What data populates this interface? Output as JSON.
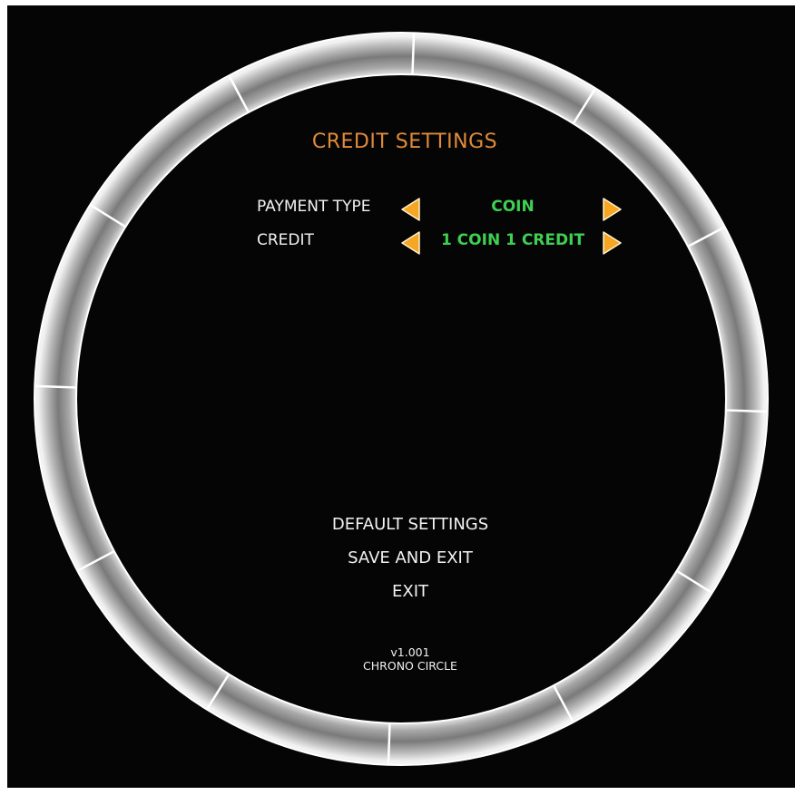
{
  "screen": {
    "title": "CREDIT SETTINGS",
    "colors": {
      "background": "#050505",
      "title": "#e08a3a",
      "label": "#f2f2f2",
      "value": "#3fcf52",
      "arrow": "#f5a623",
      "ring": "#d9d9d9"
    }
  },
  "settings": [
    {
      "label": "PAYMENT TYPE",
      "value": "COIN",
      "left_icon": "arrow-left-icon",
      "right_icon": "arrow-right-icon"
    },
    {
      "label": "CREDIT",
      "value": "1 COIN 1 CREDIT",
      "left_icon": "arrow-left-icon",
      "right_icon": "arrow-right-icon"
    }
  ],
  "menu": {
    "default_settings": "DEFAULT SETTINGS",
    "save_and_exit": "SAVE AND EXIT",
    "exit": "EXIT"
  },
  "footer": {
    "version": "v1.001",
    "game_name": "CHRONO CIRCLE"
  }
}
